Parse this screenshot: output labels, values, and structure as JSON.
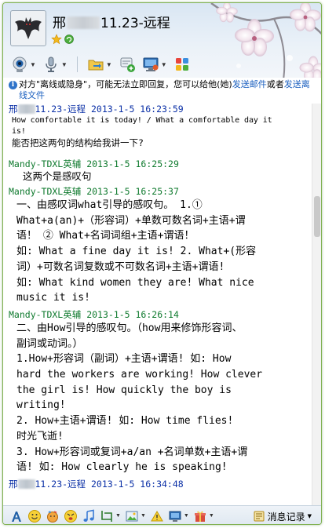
{
  "window": {
    "title_prefix": "邢",
    "title_suffix": "11.23-远程"
  },
  "notice": {
    "text_before": "对方\"离线或隐身\"，可能无法立即回复，您可以给他(她)",
    "link1": "发送邮件",
    "text_mid": "或者",
    "link2": "发送离线文件"
  },
  "messages": [
    {
      "sender_prefix": "邢",
      "sender_suffix": "11.23-远程",
      "timestamp": "2013-1-5 16:23:59",
      "lines": [
        "How comfortable it is today!  /  What a comfortable day it",
        "is!"
      ],
      "lines2": [
        "能否把这两句的结构给我讲一下?"
      ]
    },
    {
      "sender": "Mandy-TDXL英辅",
      "timestamp": "2013-1-5 16:25:29",
      "lines": [
        "这两个是感叹句"
      ]
    },
    {
      "sender": "Mandy-TDXL英辅",
      "timestamp": "2013-1-5 16:25:37",
      "lines": [
        "一、由感叹词what引导的感叹句。      1.①",
        "What+a(an)+（形容词）+单数可数名词+主语+谓",
        "语！      ② What+名词词组+主语+谓语！",
        "如: What a fine day it is!     2. What+(形容",
        "词）+可数名词复数或不可数名词+主语+谓语!",
        "如: What kind women they are!     What nice",
        "music it is!"
      ]
    },
    {
      "sender": "Mandy-TDXL英辅",
      "timestamp": "2013-1-5 16:26:14",
      "lines": [
        "二、由How引导的感叹句。（how用来修饰形容词、",
        "副词或动词。）",
        "1.How+形容词（副词）+主语+谓语!       如: How",
        "hard the workers are working!     How clever",
        "the girl is!     How quickly the boy is",
        "writing!",
        "2. How+主语+谓语!       如: How time flies!",
        "时光飞逝!",
        "3. How+形容词或复词+a/an +名词单数+主语+谓",
        "语!      如: How clearly he is speaking!"
      ]
    },
    {
      "sender_prefix": "邢",
      "sender_suffix": "11.23-远程",
      "timestamp": "2013-1-5 16:34:48",
      "lines": []
    }
  ],
  "bottom_toolbar": {
    "history_label": "消息记录"
  },
  "colors": {
    "self_name": "#0a2fa6",
    "other_name": "#0f7a2e",
    "link": "#1a5fbf",
    "border": "#7fb04f"
  },
  "icons": {
    "toolbar": [
      "video-call-icon",
      "voice-call-icon",
      "file-transfer-icon",
      "invite-chat-icon",
      "remote-desktop-icon",
      "apps-icon"
    ],
    "bottom": [
      "font-icon",
      "emoticon-icon",
      "magic-emoticon-icon",
      "nudge-icon",
      "music-icon",
      "screenshot-icon",
      "image-icon",
      "multi-send-icon",
      "remote-assist-icon",
      "gift-icon",
      "history-icon"
    ]
  }
}
